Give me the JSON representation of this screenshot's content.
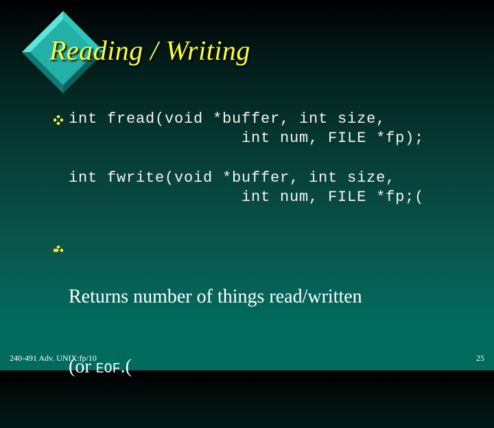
{
  "slide": {
    "title": "Reading / Writing",
    "bullets": [
      {
        "type": "code",
        "lines": [
          "int fread(void *buffer, int size,",
          "                  int num, FILE *fp);"
        ]
      },
      {
        "type": "code",
        "lines": [
          "int fwrite(void *buffer, int size,",
          "                  int num, FILE *fp;("
        ]
      },
      {
        "type": "text",
        "line1": "Returns number of things read/written",
        "line2_prefix": "(or ",
        "line2_code": "EOF",
        "line2_suffix": ".("
      }
    ],
    "footer": {
      "left": "240-491 Adv. UNIX:fp/10",
      "page_number": "25"
    }
  },
  "icons": {
    "title_decoration": "diamond-icon",
    "bullet": "diamond-bullet-icon"
  },
  "colors": {
    "title": "#ffff33",
    "bullet": "#ffff33",
    "body_text": "#ffffff",
    "diamond": "#20b2aa",
    "background_bottom": "#006a5f"
  }
}
